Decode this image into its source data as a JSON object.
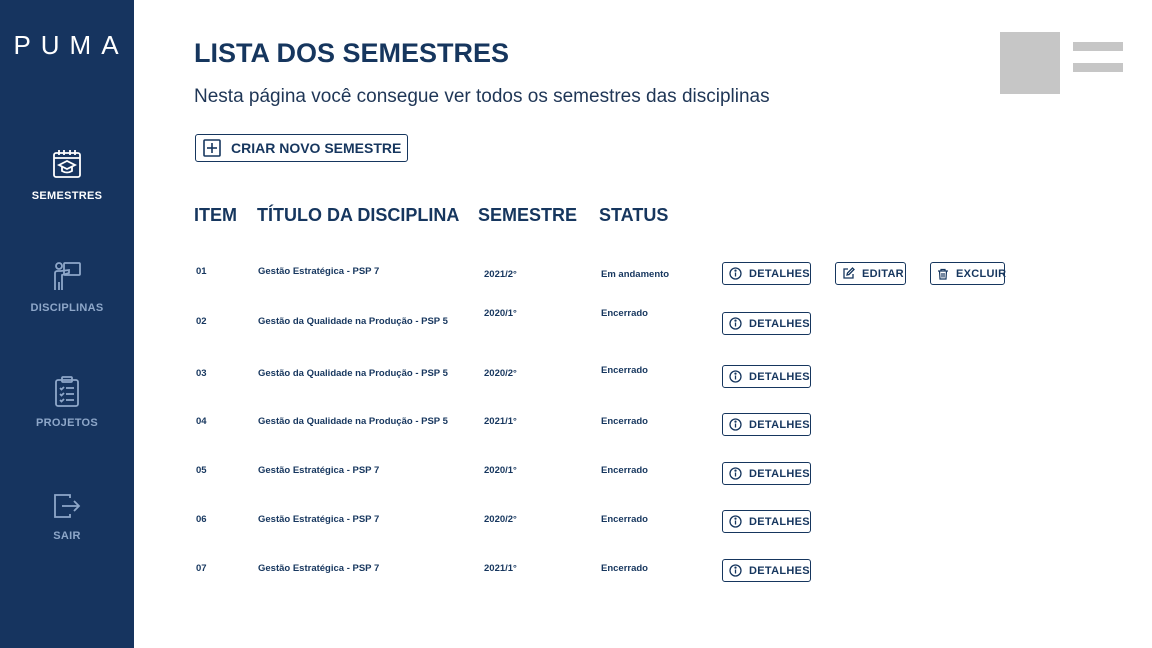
{
  "sidebar": {
    "logo": "PUMA",
    "items": [
      {
        "label": "SEMESTRES",
        "icon": "calendar-graduation-icon"
      },
      {
        "label": "DISCIPLINAS",
        "icon": "teacher-board-icon"
      },
      {
        "label": "PROJETOS",
        "icon": "clipboard-checklist-icon"
      },
      {
        "label": "SAIR",
        "icon": "logout-icon"
      }
    ]
  },
  "header": {
    "title": "LISTA DOS SEMESTRES",
    "subtitle": "Nesta página você consegue ver todos os semestres das disciplinas",
    "create_button": "CRIAR NOVO SEMESTRE"
  },
  "table": {
    "columns": [
      "ITEM",
      "TÍTULO DA DISCIPLINA",
      "SEMESTRE",
      "STATUS"
    ],
    "rows": [
      {
        "item": "01",
        "title": "Gestão Estratégica - PSP 7",
        "semester": "2021/2°",
        "status": "Em andamento"
      },
      {
        "item": "02",
        "title": "Gestão da Qualidade na Produção - PSP 5",
        "semester": "2020/1°",
        "status": "Encerrado"
      },
      {
        "item": "03",
        "title": "Gestão da Qualidade na Produção - PSP 5",
        "semester": "2020/2°",
        "status": "Encerrado"
      },
      {
        "item": "04",
        "title": "Gestão da Qualidade na Produção - PSP 5",
        "semester": "2021/1°",
        "status": "Encerrado"
      },
      {
        "item": "05",
        "title": "Gestão Estratégica - PSP 7",
        "semester": "2020/1°",
        "status": "Encerrado"
      },
      {
        "item": "06",
        "title": "Gestão Estratégica - PSP 7",
        "semester": "2020/2°",
        "status": "Encerrado"
      },
      {
        "item": "07",
        "title": "Gestão Estratégica - PSP 7",
        "semester": "2021/1°",
        "status": "Encerrado"
      }
    ],
    "actions": {
      "details": "DETALHES",
      "edit": "EDITAR",
      "delete": "EXCLUIR"
    }
  },
  "colors": {
    "sidebar_bg": "#16345f",
    "primary": "#16365e",
    "inactive_nav": "#8ea7c9",
    "placeholder": "#c6c6c6"
  }
}
